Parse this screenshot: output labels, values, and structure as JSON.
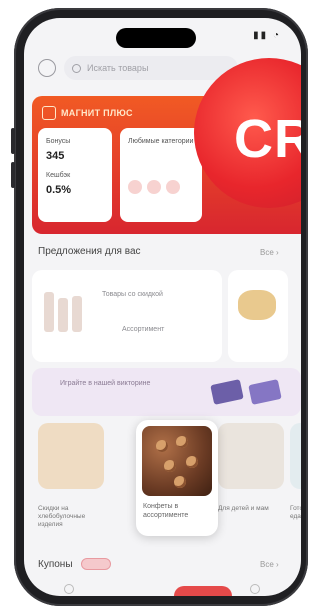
{
  "search": {
    "placeholder": "Искать товары"
  },
  "promo": {
    "title": "МАГНИТ ПЛЮС",
    "cards": [
      {
        "label": "Бонусы",
        "value": "345",
        "sub": "Кешбэк",
        "sub_value": "0.5%"
      },
      {
        "label": "Любимые категории"
      }
    ]
  },
  "badge": {
    "text": "CR"
  },
  "offers": {
    "title": "Предложения для вас",
    "see_all": "Все ›"
  },
  "offer_card": {
    "text": "Товары со скидкой",
    "link": "Ассортимент"
  },
  "promo_strip": {
    "text": "Играйте в нашей викторине"
  },
  "products": {
    "items": [
      {
        "caption": "Скидки на хлебобулочные изделия"
      },
      {
        "caption": "Конфеты в ассортименте"
      },
      {
        "caption": "Для детей и мам"
      },
      {
        "caption": "Готовая еда"
      }
    ]
  },
  "coupons": {
    "title": "Купоны",
    "see_all": "Все ›"
  },
  "colors": {
    "accent": "#d8262f",
    "badge": "#e8262c"
  }
}
